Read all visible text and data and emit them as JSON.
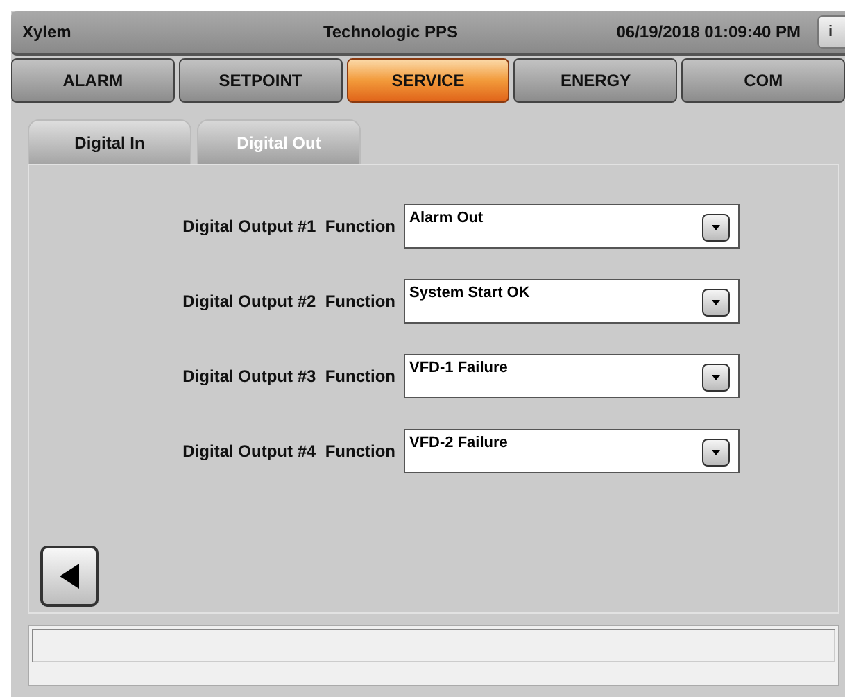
{
  "header": {
    "app": "Xylem",
    "title": "Technologic PPS",
    "datetime": "06/19/2018 01:09:40 PM",
    "info_button": "i"
  },
  "tabs": [
    {
      "label": "ALARM",
      "selected": false
    },
    {
      "label": "SETPOINT",
      "selected": false
    },
    {
      "label": "SERVICE",
      "selected": true
    },
    {
      "label": "ENERGY",
      "selected": false
    },
    {
      "label": "COM",
      "selected": false
    }
  ],
  "subtabs": [
    {
      "label": "Digital In",
      "selected": false
    },
    {
      "label": "Digital Out",
      "selected": true
    }
  ],
  "outputs": [
    {
      "label": "Digital Output #1  Function",
      "value": "Alarm Out"
    },
    {
      "label": "Digital Output #2  Function",
      "value": "System Start OK"
    },
    {
      "label": "Digital Output #3  Function",
      "value": "VFD-1 Failure"
    },
    {
      "label": "Digital Output #4  Function",
      "value": "VFD-2 Failure"
    }
  ]
}
